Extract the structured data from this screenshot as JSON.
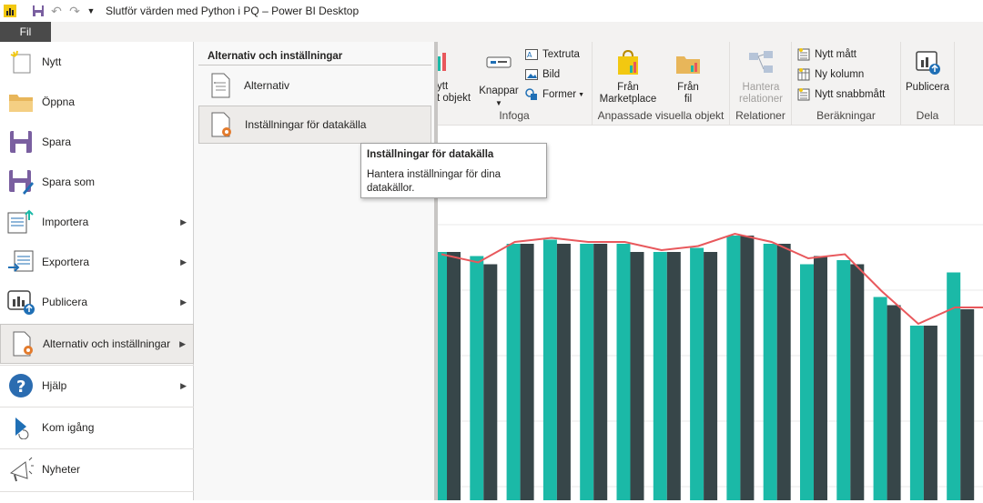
{
  "window": {
    "title": "Slutför värden med Python i PQ – Power BI Desktop"
  },
  "tabs": {
    "file": "Fil"
  },
  "menu": {
    "items": [
      {
        "label": "Nytt"
      },
      {
        "label": "Öppna"
      },
      {
        "label": "Spara"
      },
      {
        "label": "Spara som"
      },
      {
        "label": "Importera"
      },
      {
        "label": "Exportera"
      },
      {
        "label": "Publicera"
      },
      {
        "label": "Alternativ och inställningar"
      },
      {
        "label": "Hjälp"
      },
      {
        "label": "Kom igång"
      },
      {
        "label": "Nyheter"
      }
    ]
  },
  "submenu": {
    "header": "Alternativ och inställningar",
    "items": [
      {
        "label": "Alternativ"
      },
      {
        "label": "Inställningar för datakälla"
      }
    ]
  },
  "tooltip": {
    "title": "Inställningar för datakälla",
    "text": "Hantera inställningar för dina datakällor."
  },
  "ribbon": {
    "infoga": {
      "label": "Infoga",
      "visual_partial": "ytt\nt objekt",
      "buttons": "Knappar",
      "textbox": "Textruta",
      "image": "Bild",
      "shapes": "Former"
    },
    "custom_visuals": {
      "label": "Anpassade visuella objekt",
      "marketplace": "Från\nMarketplace",
      "file": "Från\nfil"
    },
    "relations": {
      "label": "Relationer",
      "manage": "Hantera\nrelationer"
    },
    "calculations": {
      "label": "Beräkningar",
      "measure": "Nytt mått",
      "column": "Ny kolumn",
      "quick": "Nytt snabbmått"
    },
    "share": {
      "label": "Dela",
      "publish": "Publicera"
    }
  },
  "colors": {
    "teal": "#1bb9a7",
    "dark": "#374649",
    "line": "#e8585c",
    "accent": "#f2c811",
    "menu_dark": "#4a4a4a"
  },
  "chart_data": {
    "type": "bar",
    "series": [
      {
        "values": [
          0.97,
          0.96,
          0.99,
          1.0,
          0.99,
          0.99,
          0.97,
          0.98,
          1.01,
          0.99,
          0.94,
          0.95,
          0.86,
          0.79,
          0.92
        ]
      },
      {
        "values": [
          0.97,
          0.94,
          0.99,
          0.99,
          0.99,
          0.97,
          0.97,
          0.97,
          1.01,
          0.99,
          0.96,
          0.94,
          0.84,
          0.79,
          0.83
        ]
      }
    ],
    "line": [
      0.96,
      0.94,
      0.99,
      1.0,
      0.99,
      0.99,
      0.97,
      0.98,
      1.01,
      0.99,
      0.95,
      0.96,
      0.87,
      0.79,
      0.83,
      0.83
    ]
  }
}
